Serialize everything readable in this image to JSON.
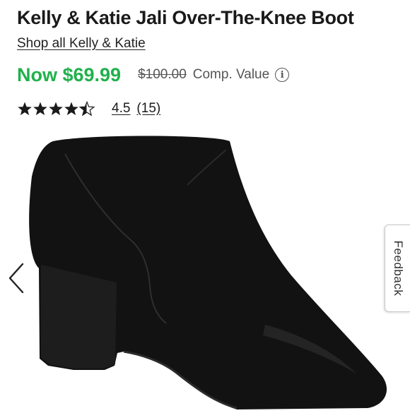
{
  "product": {
    "title": "Kelly & Katie Jali Over-The-Knee Boot",
    "shop_link": "Shop all Kelly & Katie",
    "price_now": "Now $69.99",
    "price_original": "$100.00",
    "comp_label": "Comp. Value",
    "info_icon": "info-icon",
    "rating": {
      "value_text": "4.5",
      "count_text": "(15)",
      "stars": 4.5,
      "max_stars": 5
    }
  },
  "gallery": {
    "prev_icon": "chevron-left-icon",
    "image_subject": "black suede block-heel boot"
  },
  "feedback": {
    "label": "Feedback"
  },
  "colors": {
    "price_green": "#20b14c",
    "boot": "#121212",
    "text": "#1a1a1a"
  }
}
